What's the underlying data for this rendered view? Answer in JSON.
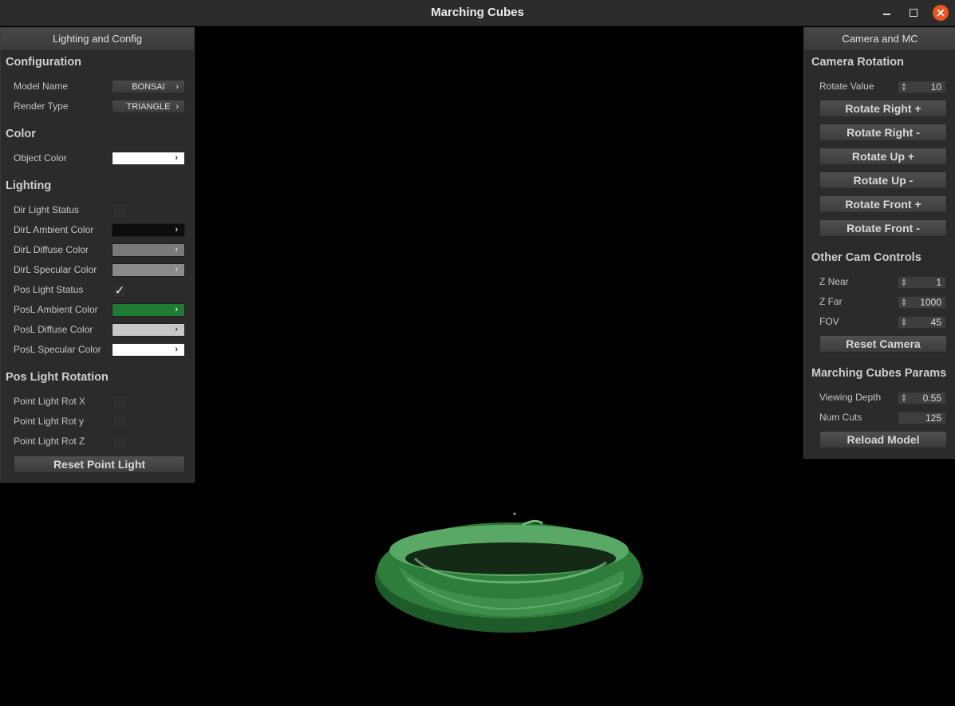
{
  "window": {
    "title": "Marching Cubes"
  },
  "left_panel": {
    "header": "Lighting and Config",
    "configuration": {
      "title": "Configuration",
      "model_name_label": "Model Name",
      "model_name_value": "BONSAI",
      "render_type_label": "Render Type",
      "render_type_value": "TRIANGLE"
    },
    "color": {
      "title": "Color",
      "object_color_label": "Object Color",
      "object_color": "#ffffff"
    },
    "lighting": {
      "title": "Lighting",
      "dir_light_status_label": "Dir Light Status",
      "dir_light_status": false,
      "dirl_ambient_label": "DirL Ambient Color",
      "dirl_ambient": "#0d0d0d",
      "dirl_diffuse_label": "DirL Diffuse Color",
      "dirl_diffuse": "#7a7a7a",
      "dirl_specular_label": "DirL Specular Color",
      "dirl_specular": "#8a8a8a",
      "pos_light_status_label": "Pos Light Status",
      "pos_light_status": true,
      "posl_ambient_label": "PosL Ambient Color",
      "posl_ambient": "#1f7a32",
      "posl_diffuse_label": "PosL Diffuse Color",
      "posl_diffuse": "#c8c8c8",
      "posl_specular_label": "PosL Specular Color",
      "posl_specular": "#ffffff"
    },
    "pos_light_rotation": {
      "title": "Pos Light Rotation",
      "rot_x_label": "Point Light Rot X",
      "rot_y_label": "Point Light Rot y",
      "rot_z_label": "Point Light Rot Z",
      "reset_button": "Reset Point Light"
    }
  },
  "right_panel": {
    "header": "Camera and MC",
    "camera_rotation": {
      "title": "Camera Rotation",
      "rotate_value_label": "Rotate Value",
      "rotate_value": "10",
      "buttons": [
        "Rotate Right +",
        "Rotate Right -",
        "Rotate Up +",
        "Rotate Up -",
        "Rotate Front +",
        "Rotate Front -"
      ]
    },
    "other_cam_controls": {
      "title": "Other Cam Controls",
      "z_near_label": "Z Near",
      "z_near": "1",
      "z_far_label": "Z Far",
      "z_far": "1000",
      "fov_label": "FOV",
      "fov": "45",
      "reset_button": "Reset Camera"
    },
    "marching_cubes": {
      "title": "Marching Cubes Params",
      "viewing_depth_label": "Viewing Depth",
      "viewing_depth": "0.55",
      "num_cuts_label": "Num Cuts",
      "num_cuts": "125",
      "reload_button": "Reload Model"
    }
  },
  "colors": {
    "model_green": "#2e7d3a",
    "model_highlight": "#6fbf7a"
  }
}
